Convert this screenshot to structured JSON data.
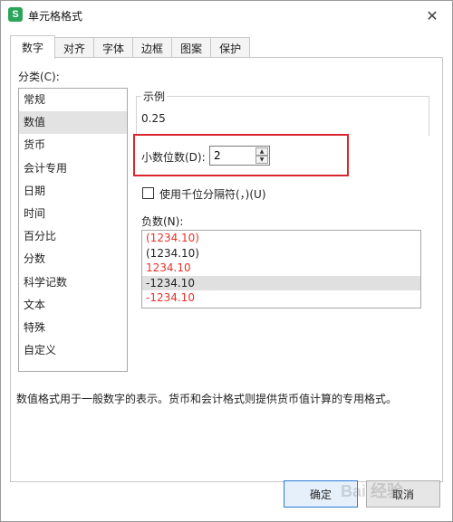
{
  "window": {
    "icon_letter": "S",
    "title": "单元格格式",
    "close_glyph": "✕"
  },
  "tabs": [
    {
      "label": "数字",
      "active": true
    },
    {
      "label": "对齐",
      "active": false
    },
    {
      "label": "字体",
      "active": false
    },
    {
      "label": "边框",
      "active": false
    },
    {
      "label": "图案",
      "active": false
    },
    {
      "label": "保护",
      "active": false
    }
  ],
  "category": {
    "label": "分类(C):",
    "items": [
      "常规",
      "数值",
      "货币",
      "会计专用",
      "日期",
      "时间",
      "百分比",
      "分数",
      "科学记数",
      "文本",
      "特殊",
      "自定义"
    ],
    "selected": "数值"
  },
  "sample": {
    "legend": "示例",
    "value": "0.25"
  },
  "decimals": {
    "label": "小数位数(D):",
    "value": "2",
    "up_glyph": "▲",
    "down_glyph": "▼"
  },
  "thousands": {
    "label": "使用千位分隔符(，)(U)",
    "checked": false
  },
  "negative": {
    "label": "负数(N):",
    "items": [
      {
        "text": "(1234.10)",
        "color": "#e8322b"
      },
      {
        "text": "(1234.10)",
        "color": "#222222"
      },
      {
        "text": "1234.10",
        "color": "#e8322b"
      },
      {
        "text": "-1234.10",
        "color": "#222222"
      },
      {
        "text": "-1234.10",
        "color": "#e8322b"
      }
    ],
    "selected_index": 3
  },
  "description": "数值格式用于一般数字的表示。货币和会计格式则提供货币值计算的专用格式。",
  "buttons": {
    "ok": "确定",
    "cancel": "取消"
  },
  "colors": {
    "highlight": "#d9262c",
    "negative_red": "#e8322b",
    "primary_border": "#2a7ad6"
  },
  "watermark": "Bai 经验"
}
